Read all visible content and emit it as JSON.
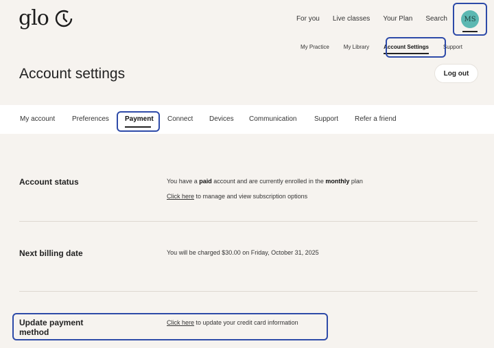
{
  "app": {
    "logo_text": "glo",
    "logo_icon": "glo-clock-icon"
  },
  "top_nav": [
    "For you",
    "Live classes",
    "Your Plan",
    "Search"
  ],
  "user": {
    "initials": "MS",
    "avatar_color": "#5cb8b2"
  },
  "sub_nav": [
    "My Practice",
    "My Library",
    "Account Settings",
    "Support"
  ],
  "sub_nav_active": "Account Settings",
  "page_title": "Account settings",
  "logout_label": "Log out",
  "tabs": [
    "My account",
    "Preferences",
    "Payment",
    "Connect",
    "Devices",
    "Communication",
    "Support",
    "Refer a friend"
  ],
  "active_tab": "Payment",
  "sections": {
    "account_status": {
      "label": "Account status",
      "line1_pre": "You have a ",
      "line1_bold1": "paid",
      "line1_mid": " account and are currently enrolled in the ",
      "line1_bold2": "monthly",
      "line1_post": " plan",
      "link": "Click here",
      "line2_post": " to manage and view subscription options"
    },
    "next_billing": {
      "label": "Next billing date",
      "text": "You will be charged $30.00 on Friday, October 31, 2025"
    },
    "update_payment": {
      "label_line1": "Update payment",
      "label_line2": "method",
      "link": "Click here",
      "text_post": " to update your credit card information"
    }
  },
  "colors": {
    "highlight": "#2d4aa8",
    "background": "#f6f3ef"
  }
}
